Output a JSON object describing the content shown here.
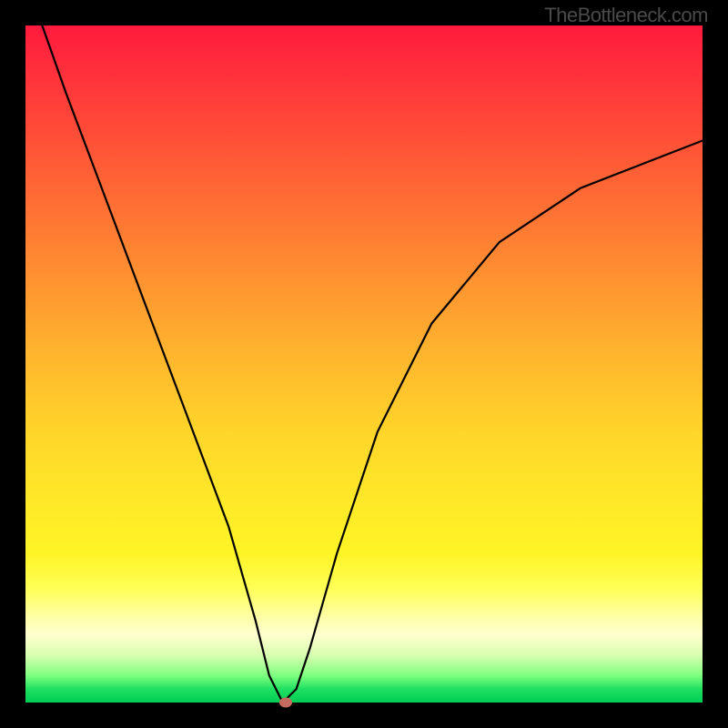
{
  "watermark": "TheBottleneck.com",
  "chart_data": {
    "type": "line",
    "title": "",
    "xlabel": "",
    "ylabel": "",
    "xlim": [
      0,
      100
    ],
    "ylim": [
      0,
      100
    ],
    "background_gradient": {
      "top": "#ff1a3d",
      "middle": "#ffd52a",
      "bottom": "#00cc55"
    },
    "curve": {
      "description": "V-shaped bottleneck curve with minimum near x≈38, left branch steep linear, right branch concave rising",
      "x": [
        0,
        6,
        12,
        18,
        24,
        30,
        34,
        36,
        38,
        40,
        42,
        46,
        52,
        60,
        70,
        82,
        100
      ],
      "y": [
        107,
        90,
        74,
        58,
        42,
        26,
        12,
        4,
        0,
        2,
        8,
        22,
        40,
        56,
        68,
        76,
        83
      ]
    },
    "marker": {
      "x": 38.5,
      "y": 0,
      "color": "#c76a5f"
    }
  }
}
